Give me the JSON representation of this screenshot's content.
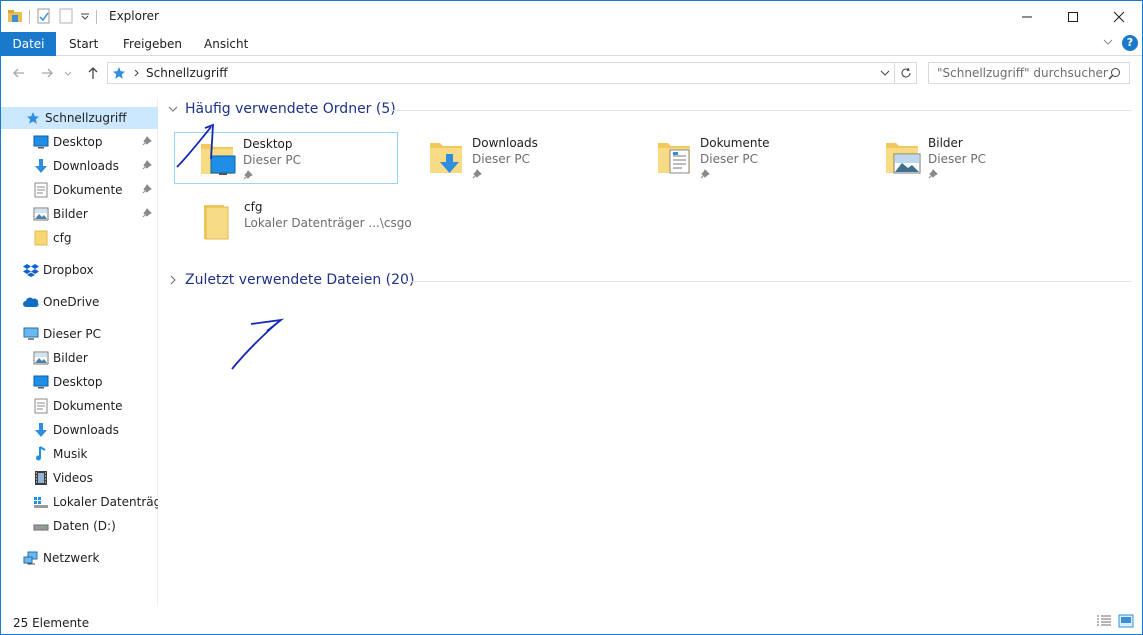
{
  "window": {
    "title": "Explorer"
  },
  "ribbon": {
    "tabs": [
      "Datei",
      "Start",
      "Freigeben",
      "Ansicht"
    ]
  },
  "address": {
    "path": "Schnellzugriff"
  },
  "search": {
    "placeholder": "\"Schnellzugriff\" durchsuchen"
  },
  "navpane": {
    "quick_access": "Schnellzugriff",
    "quick_items": [
      "Desktop",
      "Downloads",
      "Dokumente",
      "Bilder",
      "cfg"
    ],
    "dropbox": "Dropbox",
    "onedrive": "OneDrive",
    "this_pc": "Dieser PC",
    "pc_items": [
      "Bilder",
      "Desktop",
      "Dokumente",
      "Downloads",
      "Musik",
      "Videos",
      "Lokaler Datenträger",
      "Daten (D:)"
    ],
    "network": "Netzwerk"
  },
  "content": {
    "frequent_header": "Häufig verwendete Ordner (5)",
    "recent_header": "Zuletzt verwendete Dateien (20)",
    "folders": [
      {
        "name": "Desktop",
        "location": "Dieser PC",
        "icon": "desktop-folder-icon"
      },
      {
        "name": "Downloads",
        "location": "Dieser PC",
        "icon": "downloads-folder-icon"
      },
      {
        "name": "Dokumente",
        "location": "Dieser PC",
        "icon": "documents-folder-icon"
      },
      {
        "name": "Bilder",
        "location": "Dieser PC",
        "icon": "pictures-folder-icon"
      },
      {
        "name": "cfg",
        "location": "Lokaler Datenträger ...\\csgo",
        "icon": "folder-icon"
      }
    ]
  },
  "status": {
    "count": "25 Elemente"
  },
  "colors": {
    "accent": "#1979ca",
    "selection": "#cce8ff",
    "group_header": "#1e3287",
    "annotation": "#1428b4"
  }
}
